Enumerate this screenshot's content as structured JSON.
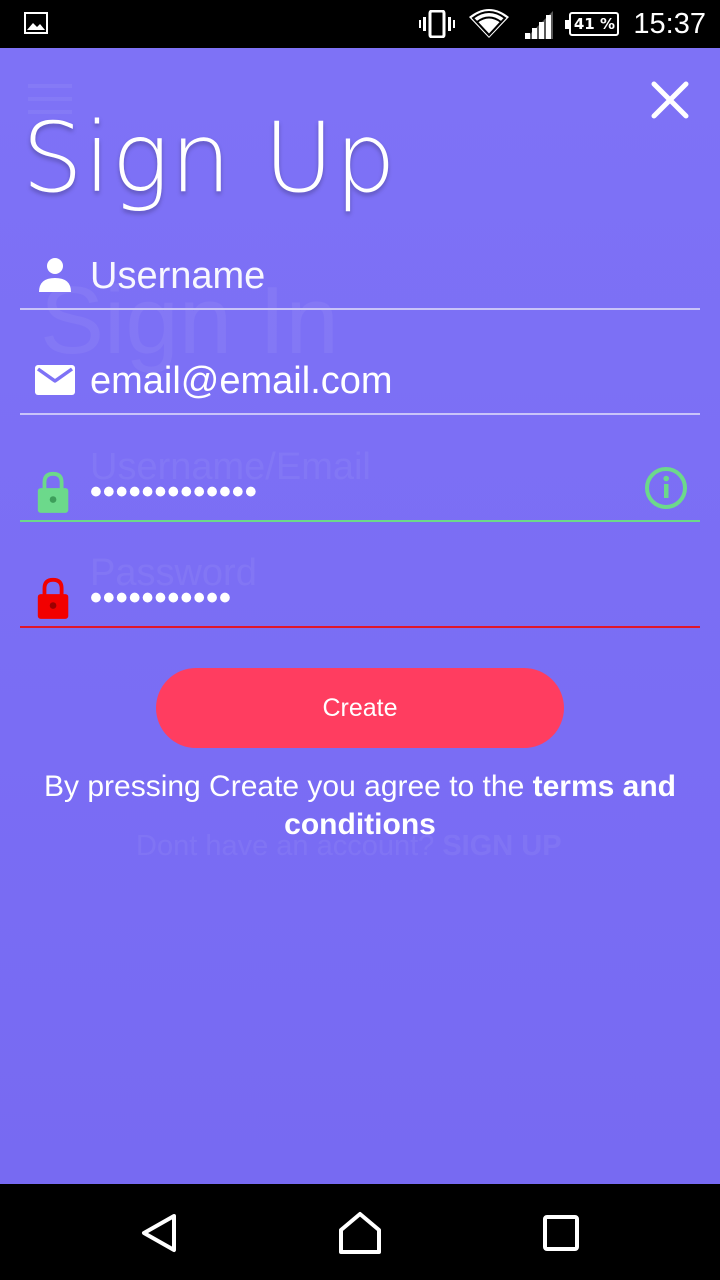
{
  "status_bar": {
    "battery": "41 %",
    "time": "15:37",
    "icons": [
      "gallery-icon",
      "vibrate-icon",
      "wifi-icon",
      "signal-icon",
      "battery-icon"
    ]
  },
  "form": {
    "title": "Sign Up",
    "username_placeholder": "Username",
    "email_value": "email@email.com",
    "password_value": "•••••••••••••",
    "confirm_password_value": "•••••••••••",
    "create_label": "Create",
    "terms_prefix": "By pressing Create you agree to the ",
    "terms_link": "terms and conditions"
  },
  "background_form": {
    "title": "Sign In",
    "username_email_placeholder": "Username/Email",
    "password_placeholder": "Password",
    "signup_prompt": "Dont have an account?",
    "signup_link": "SIGN UP"
  },
  "colors": {
    "background": "#7E72F6",
    "accent_button": "#FF3D60",
    "valid": "#6CD98B",
    "invalid": "#F20000"
  },
  "nav_bar": {
    "icons": [
      "back-icon",
      "home-icon",
      "recents-icon"
    ]
  }
}
